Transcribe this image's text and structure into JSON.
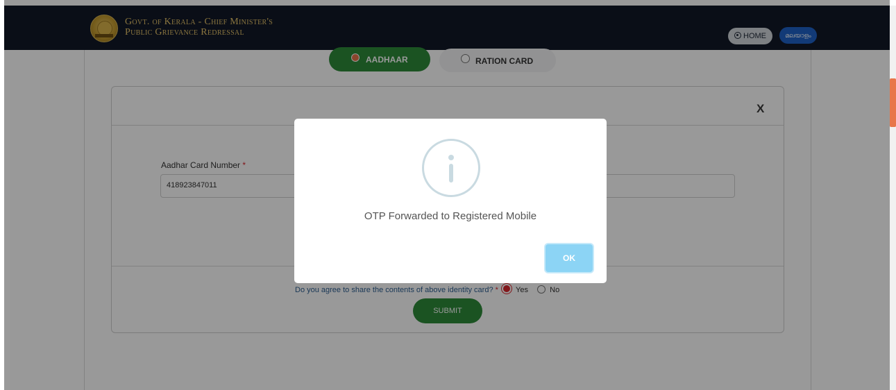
{
  "header": {
    "title_line1": "Govt. of Kerala -  Chief Minister's",
    "title_line2": "Public Grievance Redressal",
    "home_label": "HOME",
    "lang_label": "മലയാളം"
  },
  "id_type": {
    "options": [
      {
        "label": "AADHAAR",
        "selected": true
      },
      {
        "label": "RATION CARD",
        "selected": false
      }
    ]
  },
  "form": {
    "close_label": "X",
    "aadhar_label": "Aadhar Card Number",
    "required_mark": "*",
    "aadhar_value": "418923847011",
    "agree_question": "Do you agree to share the contents of above identity card?",
    "agree_yes": "Yes",
    "agree_no": "No",
    "submit_label": "SUBMIT"
  },
  "modal": {
    "message": "OTP Forwarded to Registered Mobile",
    "ok_label": "OK",
    "icon": "info-icon"
  },
  "colors": {
    "header_bg": "#111827",
    "accent_green": "#2e8b3a",
    "gold": "#e7c46a",
    "ok_blue": "#8cd4f5",
    "lang_blue": "#1f62c7"
  }
}
